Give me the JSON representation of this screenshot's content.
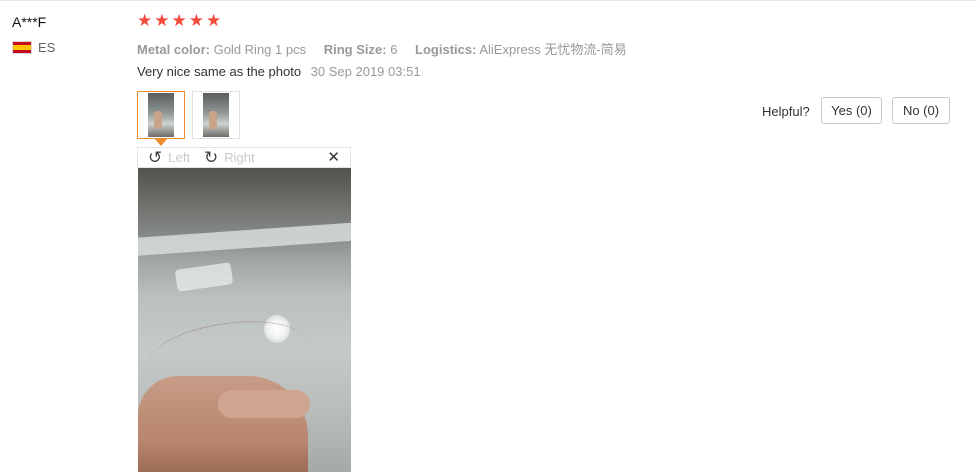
{
  "review": {
    "user_name": "A***F",
    "country_code": "ES",
    "rating": 5,
    "stars": [
      "★",
      "★",
      "★",
      "★",
      "★"
    ],
    "attributes": [
      {
        "name": "Metal color:",
        "value": "Gold Ring 1 pcs"
      },
      {
        "name": "Ring Size:",
        "value": "6"
      },
      {
        "name": "Logistics:",
        "value": "AliExpress 无忧物流-简易"
      }
    ],
    "text": "Very nice same as the photo",
    "date": "30 Sep 2019 03:51"
  },
  "viewer": {
    "rotate_left_icon": "↺",
    "rotate_left_label": "Left",
    "rotate_right_icon": "↻",
    "rotate_right_label": "Right",
    "close_icon": "✕"
  },
  "helpful": {
    "label": "Helpful?",
    "yes_label": "Yes (0)",
    "no_label": "No (0)"
  },
  "colors": {
    "star": "#f24c3d",
    "active_thumb_border": "#f08a2b"
  }
}
